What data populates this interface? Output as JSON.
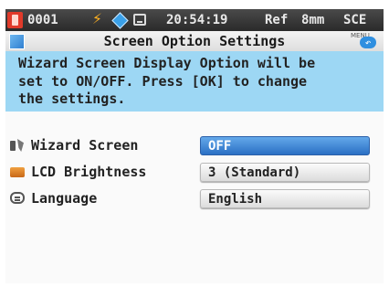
{
  "status_bar": {
    "instrument_id": "0001",
    "time": "20:54:19",
    "reference_label": "Ref",
    "aperture": "8mm",
    "specular": "SCE"
  },
  "title_bar": {
    "title": "Screen Option Settings",
    "menu_label": "MENU"
  },
  "description": {
    "text": "Wizard Screen Display Option will be\nset to ON/OFF. Press [OK] to change\nthe settings."
  },
  "settings": [
    {
      "label": "Wizard Screen",
      "value": "OFF",
      "selected": true
    },
    {
      "label": "LCD Brightness",
      "value": "3 (Standard)",
      "selected": false
    },
    {
      "label": "Language",
      "value": "English",
      "selected": false
    }
  ],
  "colors": {
    "description_background": "#9dd7f4",
    "selected_field": "#2a6fc4",
    "status_bar": "#2a2a2a"
  }
}
